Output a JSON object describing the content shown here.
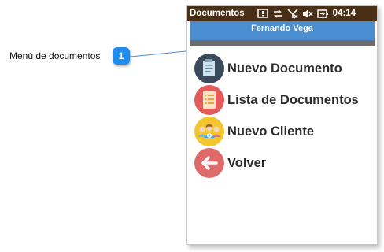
{
  "callout": {
    "label": "Menú de documentos",
    "badge": "1"
  },
  "statusbar": {
    "title": "Documentos",
    "time": "04:14",
    "icons": [
      "notification-icon",
      "connectivity-icon",
      "no-signal-icon",
      "volume-mute-icon",
      "battery-icon"
    ]
  },
  "header": {
    "user": "Fernando Vega"
  },
  "menu": {
    "items": [
      {
        "label": "Nuevo Documento",
        "icon": "new-document-icon",
        "color": "#3b4a5c"
      },
      {
        "label": "Lista de Documentos",
        "icon": "document-list-icon",
        "color": "#e55a5a"
      },
      {
        "label": "Nuevo Cliente",
        "icon": "new-client-icon",
        "color": "#f2c62f"
      },
      {
        "label": "Volver",
        "icon": "back-arrow-icon",
        "color": "#e06a6a"
      }
    ]
  },
  "colors": {
    "statusbar": "#4a2f17",
    "user_bar": "#4a8ed1",
    "separator": "#6c6c6c",
    "callout_badge": "#1f8df0"
  }
}
